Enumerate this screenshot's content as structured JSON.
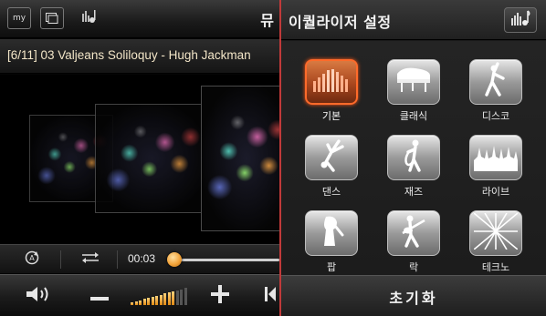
{
  "player": {
    "title": "뮤",
    "my_label": "my",
    "track": "[6/11] 03 Valjeans Soliloquy - Hugh Jackman",
    "elapsed": "00:03",
    "progress": 0.02,
    "volume_level": 0.8
  },
  "equalizer": {
    "title": "이퀄라이저 설정",
    "presets": [
      {
        "label": "기본",
        "icon": "equalizer-bars-icon",
        "selected": true
      },
      {
        "label": "클래식",
        "icon": "grand-piano-icon",
        "selected": false
      },
      {
        "label": "디스코",
        "icon": "disco-dancer-icon",
        "selected": false
      },
      {
        "label": "댄스",
        "icon": "breakdancer-icon",
        "selected": false
      },
      {
        "label": "재즈",
        "icon": "saxophone-player-icon",
        "selected": false
      },
      {
        "label": "라이브",
        "icon": "concert-crowd-icon",
        "selected": false
      },
      {
        "label": "팝",
        "icon": "pop-singer-icon",
        "selected": false
      },
      {
        "label": "락",
        "icon": "guitarist-icon",
        "selected": false
      },
      {
        "label": "테크노",
        "icon": "light-burst-icon",
        "selected": false
      }
    ],
    "reset_label": "초기화"
  },
  "colors": {
    "accent": "#ff6a2a",
    "divider": "#c13a3a",
    "track_text": "#f3e6c8"
  }
}
